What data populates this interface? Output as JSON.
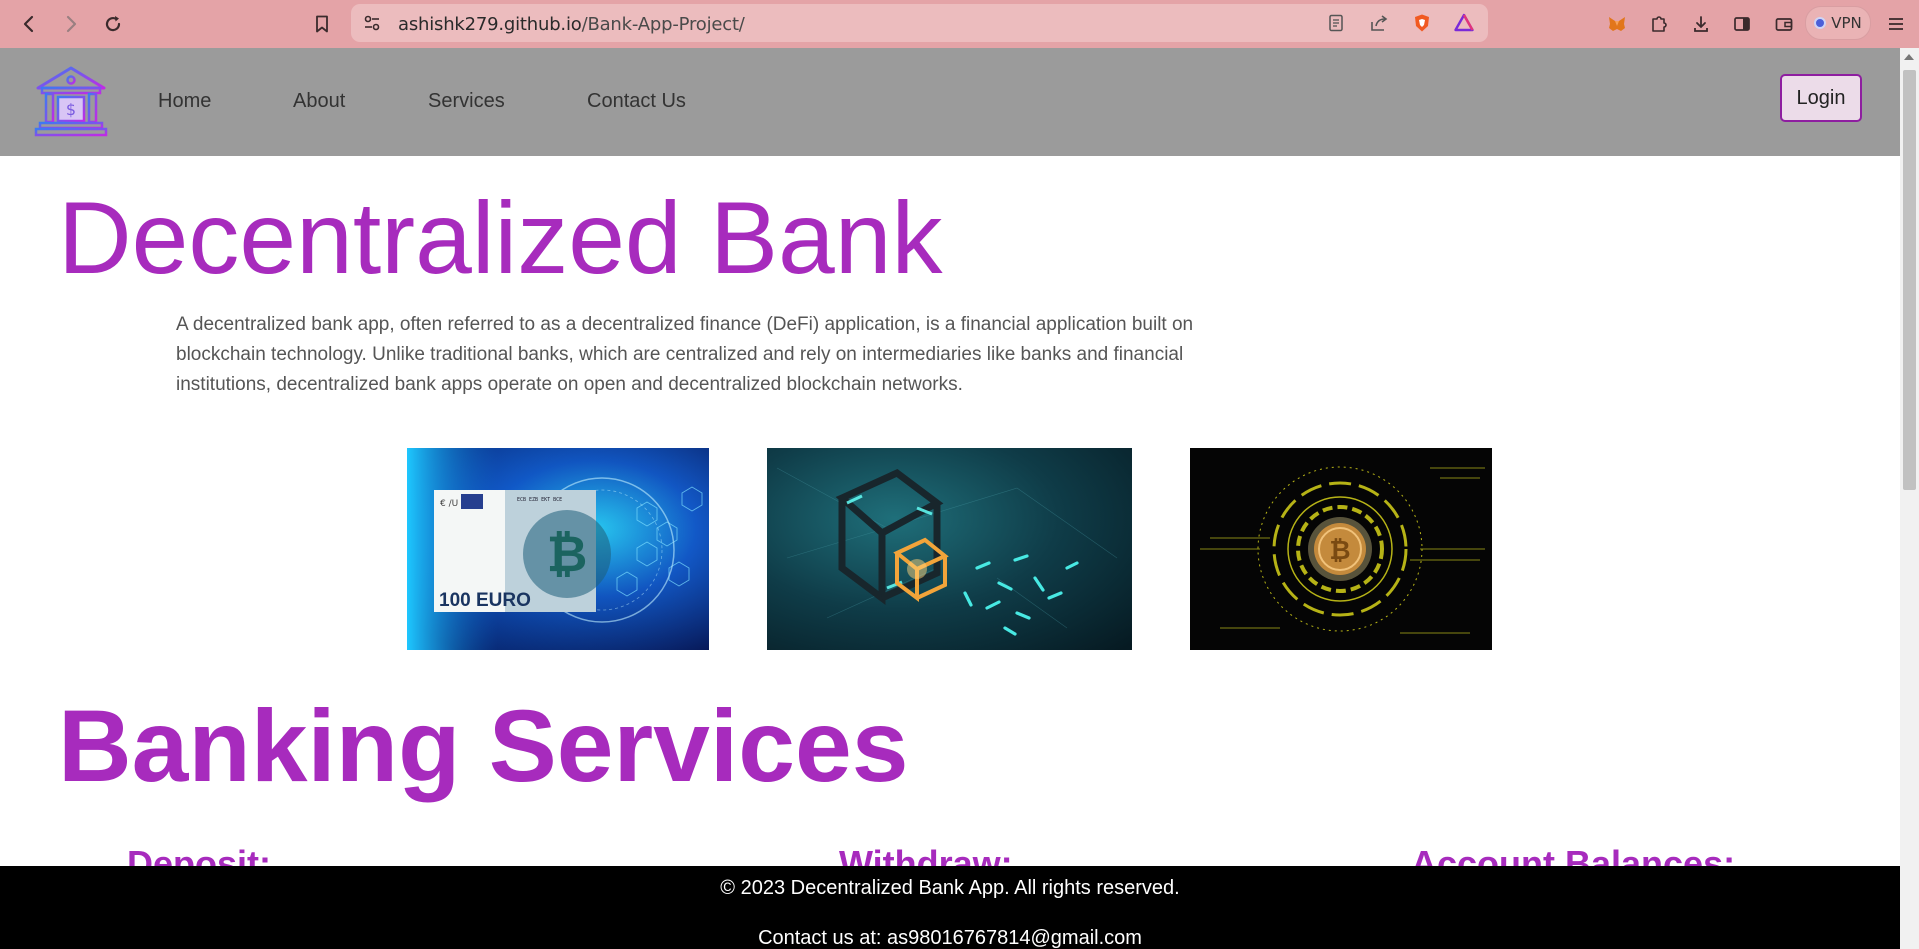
{
  "browser": {
    "url_host": "ashishk279.github.io",
    "url_path": "/Bank-App-Project/",
    "vpn_label": "VPN",
    "icons": [
      "back-icon",
      "forward-icon",
      "reload-icon",
      "bookmark-icon",
      "site-settings-icon",
      "reader-mode-icon",
      "share-icon",
      "brave-shields-icon",
      "brave-rewards-icon",
      "metamask-icon",
      "extensions-icon",
      "download-icon",
      "sidebar-icon",
      "wallet-icon",
      "menu-icon"
    ]
  },
  "nav": {
    "links": [
      "Home",
      "About",
      "Services",
      "Contact Us"
    ],
    "login_label": "Login"
  },
  "hero": {
    "title": "Decentralized Bank",
    "description": "A decentralized bank app, often referred to as a decentralized finance (DeFi) application, is a financial application built on blockchain technology. Unlike traditional banks, which are centralized and rely on intermediaries like banks and financial institutions, decentralized bank apps operate on open and decentralized blockchain networks."
  },
  "gallery": {
    "euro_note_text": "100 EURO"
  },
  "services": {
    "title": "Banking Services",
    "items": [
      "Deposit:",
      "Withdraw:",
      "Account Balances:"
    ]
  },
  "footer": {
    "copyright": "© 2023 Decentralized Bank App. All rights reserved.",
    "contact": "Contact us at: as98016767814@gmail.com"
  },
  "colors": {
    "accent": "#a72bbd",
    "navbar_bg": "#9b9b9b",
    "chrome_bg": "#e4a3a7",
    "footer_bg": "#000000"
  }
}
